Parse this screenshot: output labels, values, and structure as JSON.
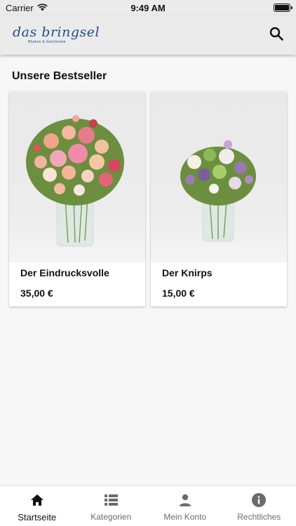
{
  "status_bar": {
    "carrier": "Carrier",
    "time": "9:49 AM"
  },
  "header": {
    "logo_text": "das bringsel",
    "logo_tagline": "Blumen & Geschenke"
  },
  "section": {
    "title": "Unsere Bestseller"
  },
  "products": [
    {
      "name": "Der Eindrucksvolle",
      "price": "35,00 €"
    },
    {
      "name": "Der Knirps",
      "price": "15,00 €"
    }
  ],
  "tabs": [
    {
      "label": "Startseite",
      "icon": "home-icon",
      "active": true
    },
    {
      "label": "Kategorien",
      "icon": "list-icon",
      "active": false
    },
    {
      "label": "Mein Konto",
      "icon": "person-icon",
      "active": false
    },
    {
      "label": "Rechtliches",
      "icon": "info-icon",
      "active": false
    }
  ],
  "colors": {
    "brand": "#234d8c",
    "brand_accent": "#e2891c",
    "header_bg": "#ebebeb",
    "page_bg": "#f7f7f7"
  }
}
